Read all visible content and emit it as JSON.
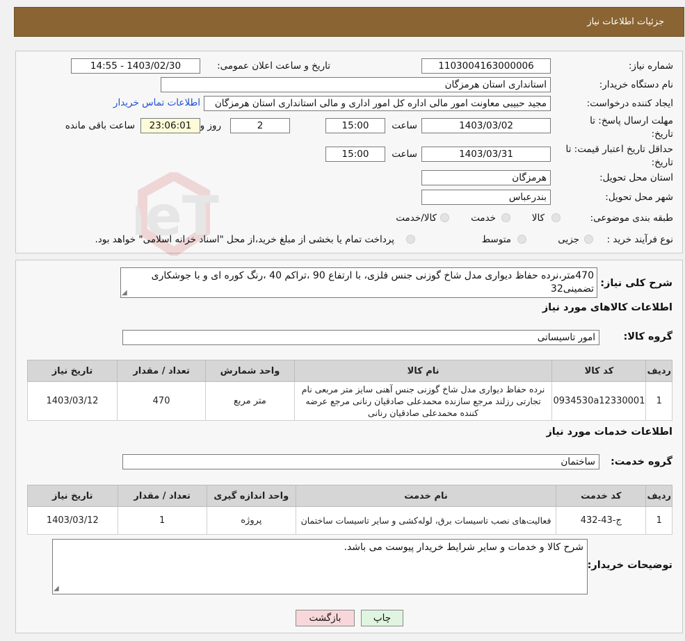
{
  "header": {
    "title": "جزئیات اطلاعات نیاز"
  },
  "form": {
    "need_number_label": "شماره نیاز:",
    "need_number": "1103004163000006",
    "announce_label": "تاریخ و ساعت اعلان عمومی:",
    "announce_value": "1403/02/30 - 14:55",
    "buyer_org_label": "نام دستگاه خریدار:",
    "buyer_org": "استانداری استان هرمزگان",
    "creator_label": "ایجاد کننده درخواست:",
    "creator": "مجید حبیبی معاونت امور مالی اداره کل امور اداری و مالی استانداری استان هرمزگان",
    "contact_link": "اطلاعات تماس خریدار",
    "deadline_label": "مهلت ارسال پاسخ: تا تاریخ:",
    "deadline_date": "1403/03/02",
    "time_label": "ساعت",
    "deadline_time": "15:00",
    "days_value": "2",
    "days_label": "روز و",
    "remaining_time": "23:06:01",
    "remaining_label": "ساعت باقی مانده",
    "validity_label": "حداقل تاریخ اعتبار قیمت: تا تاریخ:",
    "validity_date": "1403/03/31",
    "validity_time": "15:00",
    "province_label": "استان محل تحویل:",
    "province": "هرمزگان",
    "city_label": "شهر محل تحویل:",
    "city": "بندرعباس",
    "category_label": "طبقه بندی موضوعی:",
    "category_options": [
      "کالا",
      "خدمت",
      "کالا/خدمت"
    ],
    "process_label": "نوع فرآیند خرید :",
    "process_options": [
      "جزیی",
      "متوسط"
    ],
    "process_note": "پرداخت تمام یا بخشی از مبلغ خرید،از محل \"اسناد خزانه اسلامی\" خواهد بود."
  },
  "desc": {
    "label": "شرح کلی نیاز:",
    "text": "470متر،نرده حفاظ دیواری مدل شاخ گوزنی جنس فلزی، با ارتفاع 90 ،تراکم 40 ،رنگ کوره ای و با جوشکاری تضمینی32"
  },
  "goods": {
    "section_title": "اطلاعات کالاهای مورد نیاز",
    "group_label": "گروه کالا:",
    "group_value": "امور تاسیساتی",
    "headers": [
      "ردیف",
      "کد کالا",
      "نام کالا",
      "واحد شمارش",
      "تعداد / مقدار",
      "تاریخ نیاز"
    ],
    "rows": [
      {
        "row": "1",
        "code": "0934530a12330001",
        "name": "نرده حفاظ دیواری مدل شاخ گوزنی جنس آهنی سایز متر مربعی نام تجارتی رزلند مرجع سازنده محمدعلی صادقیان رنانی مرجع عرضه کننده محمدعلی صادقیان رنانی",
        "unit": "متر مربع",
        "qty": "470",
        "date": "1403/03/12"
      }
    ]
  },
  "services": {
    "section_title": "اطلاعات خدمات مورد نیاز",
    "group_label": "گروه خدمت:",
    "group_value": "ساختمان",
    "headers": [
      "ردیف",
      "کد خدمت",
      "نام خدمت",
      "واحد اندازه گیری",
      "تعداد / مقدار",
      "تاریخ نیاز"
    ],
    "rows": [
      {
        "row": "1",
        "code": "ج-43-432",
        "name": "فعالیت‌های نصب تاسیسات برق، لوله‌کشی و سایر تاسیسات ساختمان",
        "unit": "پروژه",
        "qty": "1",
        "date": "1403/03/12"
      }
    ]
  },
  "buyer_notes": {
    "label": "توضیحات خریدار:",
    "text": "شرح کالا و خدمات و سایر شرایط خریدار پیوست می باشد."
  },
  "buttons": {
    "print": "چاپ",
    "back": "بازگشت"
  },
  "watermark": {
    "text": "AriaTender.neT"
  },
  "colors": {
    "header_bg": "#8a6432",
    "link": "#1f4fd6",
    "back_button_bg": "#f8d7da",
    "print_button_bg": "#dff5df"
  }
}
